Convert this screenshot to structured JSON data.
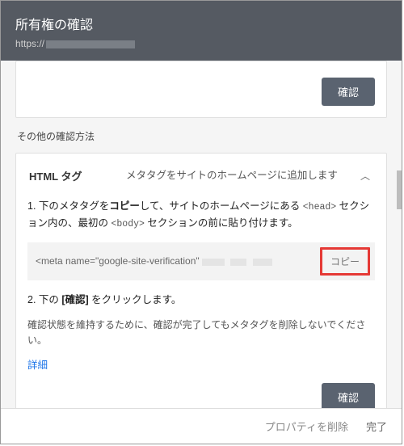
{
  "header": {
    "title": "所有権の確認",
    "url_prefix": "https://"
  },
  "top_card": {
    "confirm_label": "確認"
  },
  "section_label": "その他の確認方法",
  "method": {
    "name": "HTML タグ",
    "description": "メタタグをサイトのホームページに追加します",
    "step1_pre": "1. 下のメタタグを",
    "step1_bold": "コピー",
    "step1_mid": "して、サイトのホームページにある ",
    "step1_code1": "<head>",
    "step1_mid2": " セクション内の、最初の ",
    "step1_code2": "<body>",
    "step1_post": " セクションの前に貼り付けます。",
    "code_snippet": "<meta name=\"google-site-verification\"",
    "copy_label": "コピー",
    "step2_pre": "2. 下の ",
    "step2_bold": "[確認]",
    "step2_post": " をクリックします。",
    "note": "確認状態を維持するために、確認が完了してもメタタグを削除しないでください。",
    "details_link": "詳細",
    "confirm_label": "確認"
  },
  "footer": {
    "remove_label": "プロパティを削除",
    "done_label": "完了"
  }
}
